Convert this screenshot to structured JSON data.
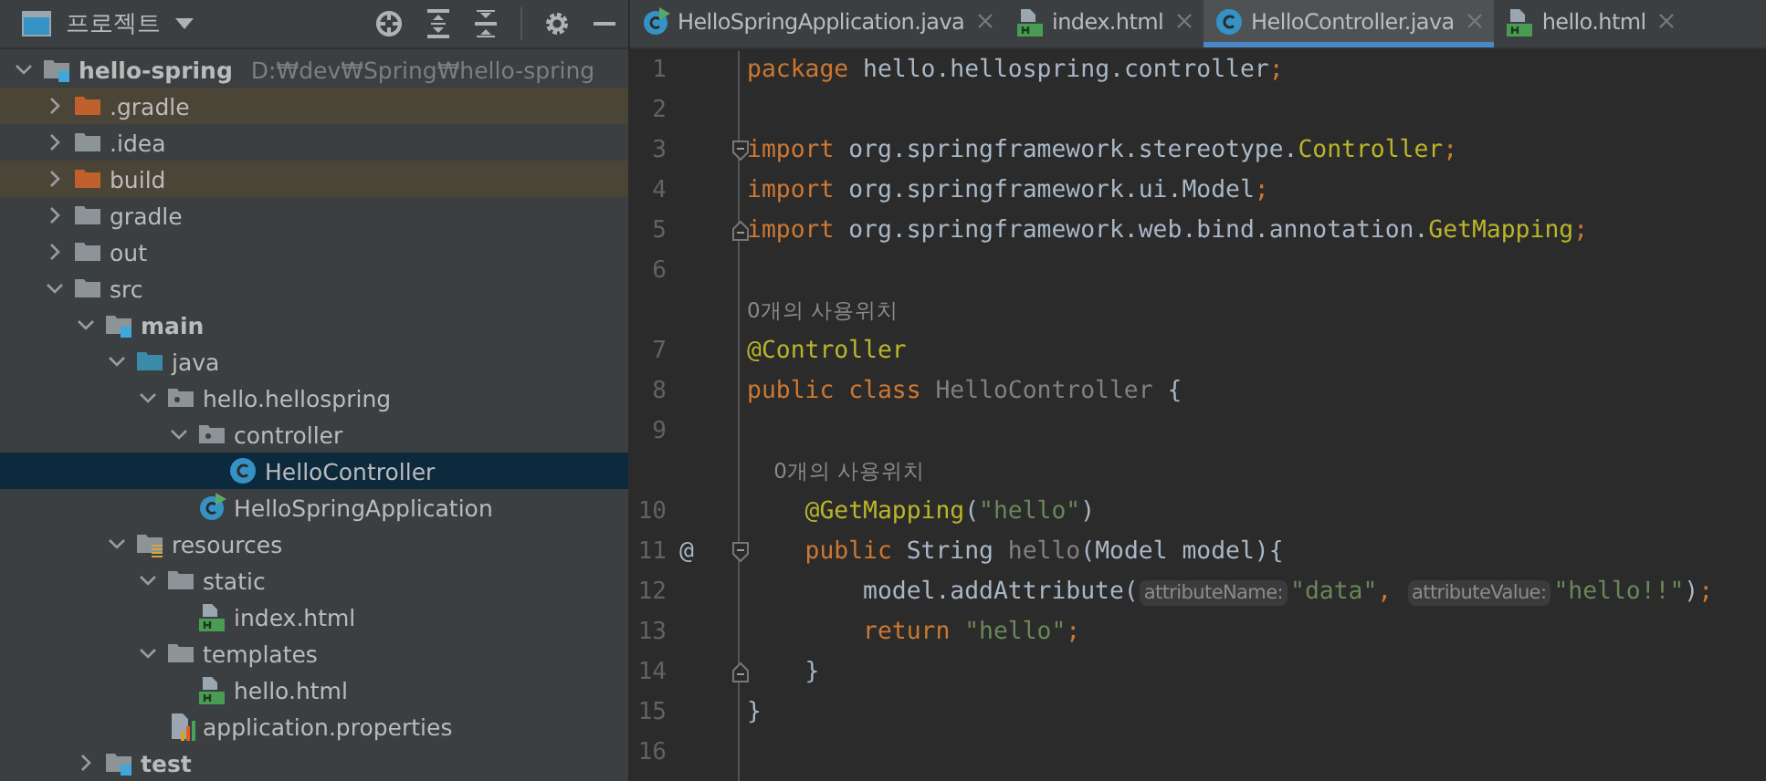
{
  "project_panel": {
    "title": "프로젝트",
    "tree": [
      {
        "name": "hello-spring",
        "kind": "module",
        "path": "D:₩dev₩Spring₩hello-spring",
        "expanded": true,
        "selected": false,
        "excluded": false,
        "children": [
          {
            "name": ".gradle",
            "kind": "folder",
            "expanded": false,
            "selected": false,
            "excluded": true
          },
          {
            "name": ".idea",
            "kind": "folder",
            "expanded": false,
            "selected": false,
            "excluded": false
          },
          {
            "name": "build",
            "kind": "folder",
            "expanded": false,
            "selected": false,
            "excluded": true
          },
          {
            "name": "gradle",
            "kind": "folder",
            "expanded": false,
            "selected": false,
            "excluded": false
          },
          {
            "name": "out",
            "kind": "folder",
            "expanded": false,
            "selected": false,
            "excluded": false
          },
          {
            "name": "src",
            "kind": "folder",
            "expanded": true,
            "selected": false,
            "excluded": false,
            "children": [
              {
                "name": "main",
                "kind": "module",
                "expanded": true,
                "selected": false,
                "excluded": false,
                "children": [
                  {
                    "name": "java",
                    "kind": "source",
                    "expanded": true,
                    "selected": false,
                    "excluded": false,
                    "children": [
                      {
                        "name": "hello.hellospring",
                        "kind": "package",
                        "expanded": true,
                        "selected": false,
                        "excluded": false,
                        "children": [
                          {
                            "name": "controller",
                            "kind": "package",
                            "expanded": true,
                            "selected": false,
                            "excluded": false,
                            "children": [
                              {
                                "name": "HelloController",
                                "kind": "class",
                                "selected": true,
                                "excluded": false
                              }
                            ]
                          },
                          {
                            "name": "HelloSpringApplication",
                            "kind": "app",
                            "selected": false,
                            "excluded": false
                          }
                        ]
                      }
                    ]
                  },
                  {
                    "name": "resources",
                    "kind": "resources",
                    "expanded": true,
                    "selected": false,
                    "excluded": false,
                    "children": [
                      {
                        "name": "static",
                        "kind": "folder",
                        "expanded": true,
                        "selected": false,
                        "excluded": false,
                        "children": [
                          {
                            "name": "index.html",
                            "kind": "html",
                            "selected": false,
                            "excluded": false
                          }
                        ]
                      },
                      {
                        "name": "templates",
                        "kind": "folder",
                        "expanded": true,
                        "selected": false,
                        "excluded": false,
                        "children": [
                          {
                            "name": "hello.html",
                            "kind": "html",
                            "selected": false,
                            "excluded": false
                          }
                        ]
                      },
                      {
                        "name": "application.properties",
                        "kind": "properties",
                        "selected": false,
                        "excluded": false
                      }
                    ]
                  }
                ]
              },
              {
                "name": "test",
                "kind": "module",
                "expanded": false,
                "selected": false,
                "excluded": false
              }
            ]
          }
        ]
      }
    ]
  },
  "tabs": [
    {
      "label": "HelloSpringApplication.java",
      "kind": "app",
      "selected": false
    },
    {
      "label": "index.html",
      "kind": "html",
      "selected": false
    },
    {
      "label": "HelloController.java",
      "kind": "class",
      "selected": true
    },
    {
      "label": "hello.html",
      "kind": "html",
      "selected": false
    }
  ],
  "editor": {
    "lines": [
      {
        "number": "1",
        "tokens": [
          {
            "kind": "kw",
            "text": "package "
          },
          {
            "kind": "id",
            "text": "hello.hellospring.controller"
          },
          {
            "kind": "punct",
            "text": ";"
          }
        ]
      },
      {
        "number": "2"
      },
      {
        "number": "3",
        "fold_open": true,
        "tokens": [
          {
            "kind": "kw",
            "text": "import "
          },
          {
            "kind": "id",
            "text": "org.springframework.stereotype."
          },
          {
            "kind": "ann",
            "text": "Controller"
          },
          {
            "kind": "punct",
            "text": ";"
          }
        ]
      },
      {
        "number": "4",
        "tokens": [
          {
            "kind": "kw",
            "text": "import "
          },
          {
            "kind": "id",
            "text": "org.springframework.ui.Model"
          },
          {
            "kind": "punct",
            "text": ";"
          }
        ]
      },
      {
        "number": "5",
        "fold_close": true,
        "tokens": [
          {
            "kind": "kw",
            "text": "import "
          },
          {
            "kind": "id",
            "text": "org.springframework.web.bind.annotation."
          },
          {
            "kind": "ann",
            "text": "GetMapping"
          },
          {
            "kind": "punct",
            "text": ";"
          }
        ]
      },
      {
        "number": "6"
      },
      {
        "kind": "usage",
        "text": "0개의 사용위치"
      },
      {
        "number": "7",
        "tokens": [
          {
            "kind": "ann",
            "text": "@Controller"
          }
        ]
      },
      {
        "number": "8",
        "tokens": [
          {
            "kind": "kw",
            "text": "public class "
          },
          {
            "kind": "unused",
            "text": "HelloController "
          },
          {
            "kind": "id",
            "text": "{"
          }
        ]
      },
      {
        "number": "9"
      },
      {
        "kind": "usage",
        "text": "    0개의 사용위치"
      },
      {
        "number": "10",
        "tokens": [
          {
            "kind": "ann",
            "text": "    @GetMapping"
          },
          {
            "kind": "id",
            "text": "("
          },
          {
            "kind": "str",
            "text": "\"hello\""
          },
          {
            "kind": "id",
            "text": ")"
          }
        ]
      },
      {
        "number": "11",
        "marker": "@",
        "fold_open": true,
        "tokens": [
          {
            "kind": "kw",
            "text": "    public "
          },
          {
            "kind": "id",
            "text": "String "
          },
          {
            "kind": "unused",
            "text": "hello"
          },
          {
            "kind": "id",
            "text": "(Model model){"
          }
        ]
      },
      {
        "number": "12",
        "tokens": [
          {
            "kind": "id",
            "text": "        model.addAttribute("
          },
          {
            "kind": "hint",
            "text": "attributeName:"
          },
          {
            "kind": "str",
            "text": "\"data\""
          },
          {
            "kind": "punct",
            "text": ", "
          },
          {
            "kind": "hint",
            "text": "attributeValue:"
          },
          {
            "kind": "str",
            "text": "\"hello!!\""
          },
          {
            "kind": "id",
            "text": ")"
          },
          {
            "kind": "punct",
            "text": ";"
          }
        ]
      },
      {
        "number": "13",
        "tokens": [
          {
            "kind": "kw",
            "text": "        return "
          },
          {
            "kind": "str",
            "text": "\"hello\""
          },
          {
            "kind": "punct",
            "text": ";"
          }
        ]
      },
      {
        "number": "14",
        "fold_close": true,
        "tokens": [
          {
            "kind": "id",
            "text": "    }"
          }
        ]
      },
      {
        "number": "15",
        "tokens": [
          {
            "kind": "id",
            "text": "}"
          }
        ]
      },
      {
        "number": "16"
      }
    ]
  }
}
